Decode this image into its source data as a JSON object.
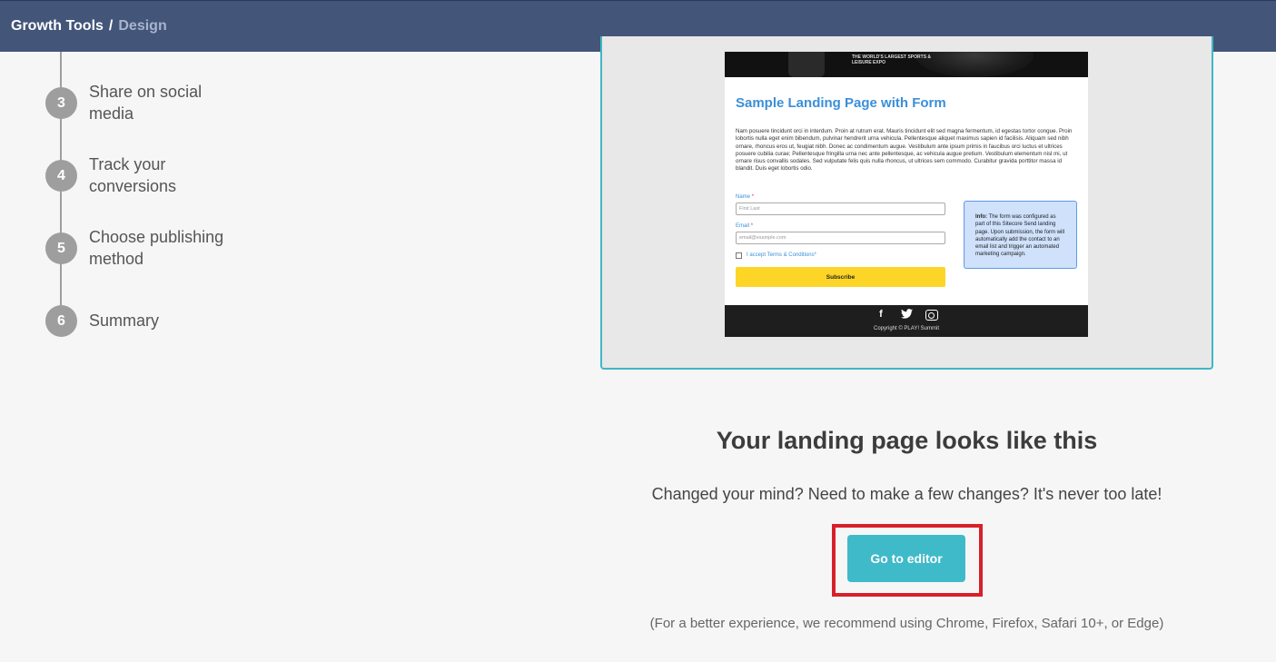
{
  "breadcrumb": {
    "root": "Growth Tools",
    "separator": "/",
    "current": "Design"
  },
  "steps": [
    {
      "number": "3",
      "label": "Share on social media"
    },
    {
      "number": "4",
      "label": "Track your conversions"
    },
    {
      "number": "5",
      "label": "Choose publishing method"
    },
    {
      "number": "6",
      "label": "Summary"
    }
  ],
  "preview": {
    "hero_text": "THE WORLD'S LARGEST SPORTS & LEISURE EXPO",
    "title": "Sample Landing Page with Form",
    "body": "Nam posuere tincidunt orci in interdum. Proin at rutrum erat. Mauris tincidunt elit sed magna fermentum, id egestas tortor congue. Proin lobortis nulla eget enim bibendum, pulvinar hendrerit urna vehicula. Pellentesque aliquet maximus sapien id facilisis. Aliquam sed nibh ornare, rhoncus eros ut, feugiat nibh. Donec ac condimentum augue. Vestibulum ante ipsum primis in faucibus orci luctus et ultrices posuere cubilia curae; Pellentesque fringilla urna nec ante pellentesque, ac vehicula augue pretium. Vestibulum elementum nisl mi, ut ornare risus convallis sodales. Sed vulputate felis quis nulla rhoncus, ut ultrices sem commodo. Curabitur gravida porttitor massa id blandit. Duis eget lobortis odio.",
    "name_label": "Name",
    "name_placeholder": "First Last",
    "email_label": "Email",
    "email_placeholder": "email@example.com",
    "required_mark": "*",
    "accept_prefix": "I accept ",
    "accept_link": "Terms & Conditions",
    "subscribe_label": "Subscribe",
    "info_bold": "Info:",
    "info_text": " The form was configured as part of this Sitecore Send landing page. Upon submission, the form will automatically add the contact to an email list and trigger an automated marketing campaign.",
    "social_icons": [
      "facebook-icon",
      "twitter-icon",
      "instagram-icon"
    ],
    "social_glyphs": {
      "facebook": "f",
      "twitter": "🐦"
    },
    "copyright": "Copyright © PLAY! Summit"
  },
  "main": {
    "heading": "Your landing page looks like this",
    "subtext": "Changed your mind? Need to make a few changes? It's never too late!",
    "editor_button": "Go to editor",
    "note": "(For a better experience, we recommend using Chrome, Firefox, Safari 10+, or Edge)"
  },
  "colors": {
    "topbar": "#435579",
    "accent": "#3fbac9",
    "highlight": "#d7202a",
    "step_circle": "#9e9e9e"
  }
}
